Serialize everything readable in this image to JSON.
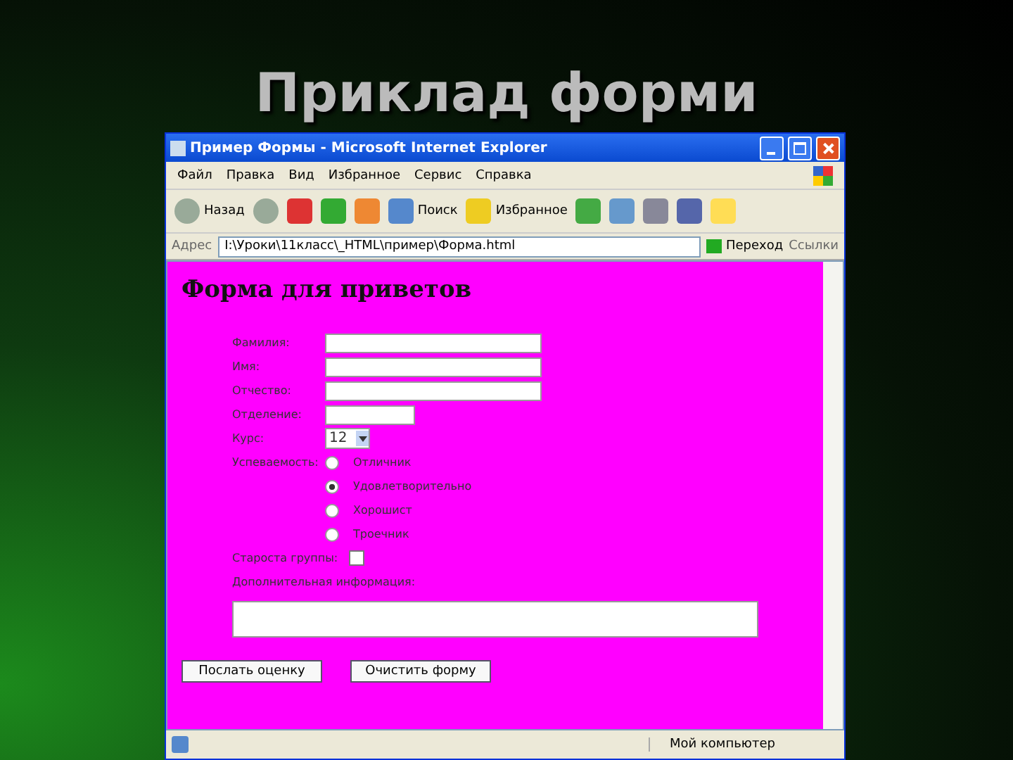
{
  "slide": {
    "title": "Приклад форми"
  },
  "window": {
    "title": "Пример Формы - Microsoft Internet Explorer"
  },
  "menu": [
    "Файл",
    "Правка",
    "Вид",
    "Избранное",
    "Сервис",
    "Справка"
  ],
  "toolbar": [
    {
      "kind": "back",
      "label": "Назад"
    },
    {
      "kind": "forward"
    },
    {
      "kind": "stop"
    },
    {
      "kind": "refresh"
    },
    {
      "kind": "home"
    },
    {
      "kind": "search",
      "label": "Поиск"
    },
    {
      "kind": "favorites",
      "label": "Избранное"
    },
    {
      "kind": "history"
    },
    {
      "kind": "mail"
    },
    {
      "kind": "print"
    },
    {
      "kind": "edit"
    },
    {
      "kind": "note"
    }
  ],
  "address": {
    "label": "Адрес",
    "value": "I:\\Уроки\\11класс\\_HTML\\пример\\Форма.html",
    "go": "Переход",
    "links": "Ссылки"
  },
  "page": {
    "heading": "Форма для приветов",
    "fields": [
      {
        "kind": "long_text",
        "label": "Фамилия:"
      },
      {
        "kind": "long_text",
        "label": "Имя:"
      },
      {
        "kind": "long_text",
        "label": "Отчество:"
      },
      {
        "kind": "short_text",
        "label": "Отделение:"
      },
      {
        "kind": "select",
        "label": "Курс:",
        "value": "12"
      }
    ],
    "radio_label": "Успеваемость:",
    "radios": [
      {
        "label": "Отличник",
        "selected": false
      },
      {
        "label": "Удовлетворительно",
        "selected": true
      },
      {
        "label": "Хорошист",
        "selected": false
      },
      {
        "label": "Троечник",
        "selected": false
      }
    ],
    "checkbox": {
      "label": "Староста группы:",
      "checked": false
    },
    "textarea_label": "Дополнительная информация:",
    "buttons": [
      "Послать оценку",
      "Очистить форму"
    ]
  },
  "status_bar": {
    "zone": "Мой компьютер"
  }
}
